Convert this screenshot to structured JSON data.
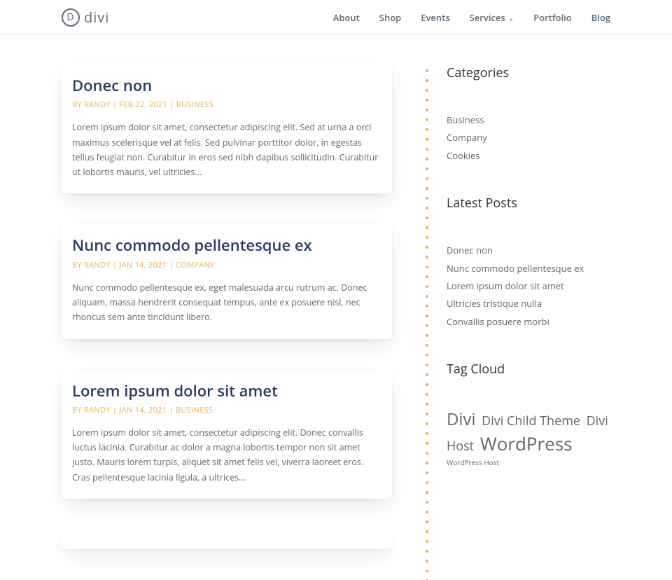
{
  "logo": {
    "letter": "D",
    "text": "divi"
  },
  "nav": {
    "about": "About",
    "shop": "Shop",
    "events": "Events",
    "services": "Services",
    "portfolio": "Portfolio",
    "blog": "Blog"
  },
  "posts": [
    {
      "title": "Donec non",
      "by": "BY ",
      "author": "RANDY",
      "sep1": " | ",
      "date": "FEB 22, 2021",
      "sep2": " | ",
      "category": "BUSINESS",
      "excerpt": "Lorem ipsum dolor sit amet, consectetur adipiscing elit. Sed at urna a orci maximus scelerisque vel at felis. Sed pulvinar porttitor dolor, in egestas tellus feugiat non. Curabitur in eros sed nibh dapibus sollicitudin. Curabitur ut lobortis mauris, vel ultricies..."
    },
    {
      "title": "Nunc commodo pellentesque ex",
      "by": "BY ",
      "author": "RANDY",
      "sep1": " | ",
      "date": "JAN 14, 2021",
      "sep2": " | ",
      "category": "COMPANY",
      "excerpt": "Nunc commodo pellentesque ex, eget malesuada arcu rutrum ac. Donec aliquam, massa hendrerit consequat tempus, ante ex posuere nisl, nec rhoncus sem ante tincidunt libero."
    },
    {
      "title": "Lorem ipsum dolor sit amet",
      "by": "BY ",
      "author": "RANDY",
      "sep1": " | ",
      "date": "JAN 14, 2021",
      "sep2": " | ",
      "category": "BUSINESS",
      "excerpt": "Lorem ipsum dolor sit amet, consectetur adipiscing elit. Donec convallis luctus lacinia. Curabitur ac dolor a magna lobortis tempor non sit amet justo. Mauris lorem turpis, aliquet sit amet felis vel, viverra laoreet eros. Cras pellentesque lacinia ligula, a ultrices..."
    }
  ],
  "sidebar": {
    "categories_title": "Categories",
    "categories": [
      "Business",
      "Company",
      "Cookies"
    ],
    "latest_title": "Latest Posts",
    "latest": [
      "Donec non",
      "Nunc commodo pellentesque ex",
      "Lorem ipsum dolor sit amet",
      "Ultricies tristique nulla",
      "Convallis posuere morbi"
    ],
    "tagcloud_title": "Tag Cloud",
    "tags": [
      {
        "label": "Divi",
        "size": "24px"
      },
      {
        "label": "Divi Child Theme",
        "size": "18px"
      },
      {
        "label": "Divi Host",
        "size": "18px"
      },
      {
        "label": "WordPress",
        "size": "26px"
      },
      {
        "label": "WordPress Host",
        "size": "10px"
      }
    ]
  }
}
